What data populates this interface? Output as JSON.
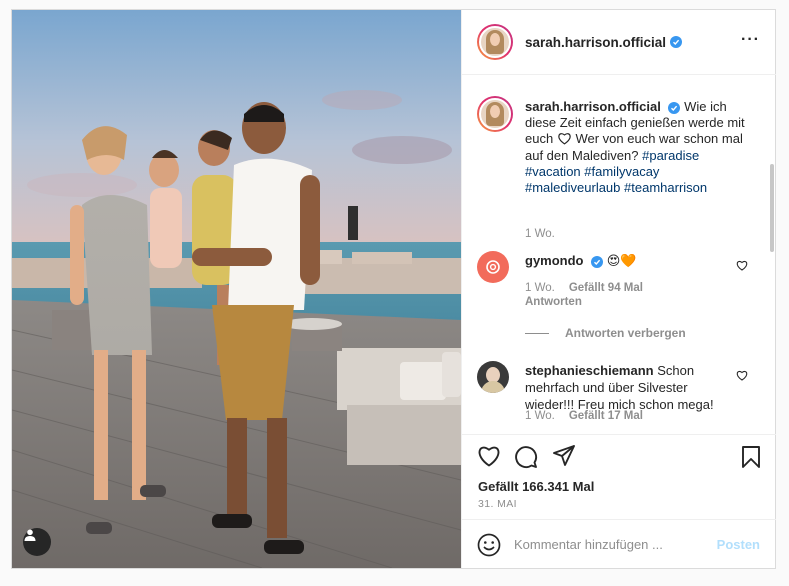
{
  "post": {
    "username": "sarah.harrison.official",
    "more_icon": "···"
  },
  "caption": {
    "username": "sarah.harrison.official",
    "text_1": "Wie ich diese Zeit einfach genießen werde mit euch",
    "text_2": "Wer von euch war schon mal auf den Malediven?",
    "tags": [
      "#paradise",
      "#vacation",
      "#familyvacay",
      "#malediveurlaub",
      "#teamharrison"
    ],
    "time": "1 Wo."
  },
  "comments": [
    {
      "username": "gymondo",
      "text": "😍🧡",
      "time": "1 Wo.",
      "likes": "Gefällt 94 Mal",
      "reply": "Antworten",
      "avatar_color": "#f26b5b"
    },
    {
      "username": "stephanieschiemann",
      "text": "Schon mehrfach und über Silvester wieder!!! Freu mich schon mega!",
      "time": "1 Wo.",
      "likes": "Gefällt 17 Mal",
      "avatar_color": "#3a3a3a"
    }
  ],
  "replies_toggle": "Antworten verbergen",
  "stats": {
    "likes": "Gefällt 166.341 Mal",
    "date": "31. MAI"
  },
  "add_comment": {
    "placeholder": "Kommentar hinzufügen ...",
    "post_label": "Posten"
  },
  "icons": {
    "like": "heart-icon",
    "comment": "comment-icon",
    "share": "paper-plane-icon",
    "save": "bookmark-icon",
    "emoji": "smiley-icon",
    "tag": "user-tag-icon",
    "verified": "verified-badge-icon"
  },
  "colors": {
    "link": "#00376b",
    "verified": "#3897f0",
    "post_disabled": "#b2dffc",
    "muted": "#8e8e8e"
  }
}
